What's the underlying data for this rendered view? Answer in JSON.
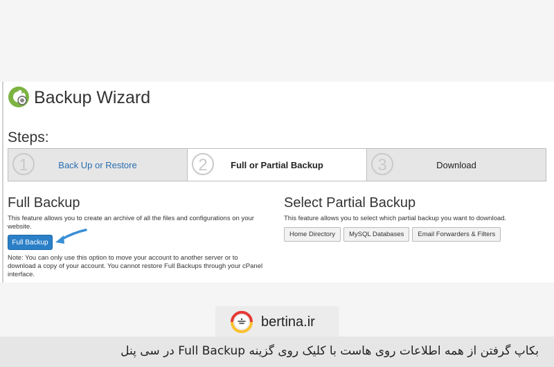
{
  "header": {
    "title": "Backup Wizard",
    "logo_icon": "cpanel-backup-icon"
  },
  "steps": {
    "title": "Steps:",
    "items": [
      {
        "num": "1",
        "label": "Back Up or Restore"
      },
      {
        "num": "2",
        "label": "Full or Partial Backup"
      },
      {
        "num": "3",
        "label": "Download"
      }
    ]
  },
  "full_backup": {
    "title": "Full Backup",
    "description": "This feature allows you to create an archive of all the files and configurations on your website.",
    "button_label": "Full Backup",
    "note": "Note: You can only use this option to move your account to another server or to download a copy of your account. You cannot restore Full Backups through your cPanel interface."
  },
  "partial_backup": {
    "title": "Select Partial Backup",
    "description": "This feature allows you to select which partial backup you want to download.",
    "buttons": [
      "Home Directory",
      "MySQL Databases",
      "Email Forwarders & Filters"
    ]
  },
  "brand": {
    "name": "bertina.ir"
  },
  "caption": {
    "text": "بکاپ گرفتن از همه اطلاعات روی هاست با کلیک روی گزینه Full Backup در سی پنل"
  },
  "colors": {
    "primary": "#2b7fc7",
    "link": "#2a6db0",
    "logo_green": "#7cb342",
    "brand_red": "#e53935",
    "brand_yellow": "#fbc02d"
  }
}
